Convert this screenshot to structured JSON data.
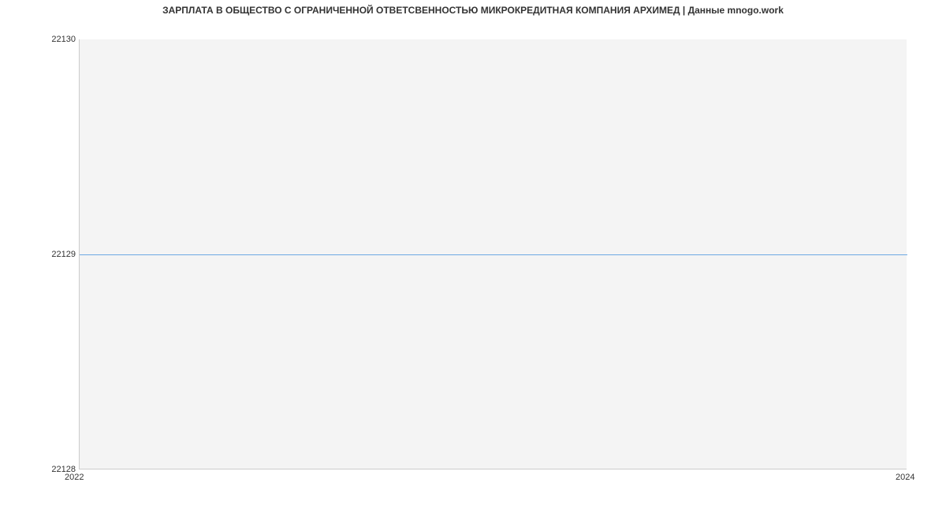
{
  "chart_data": {
    "type": "line",
    "title": "ЗАРПЛАТА В ОБЩЕСТВО С ОГРАНИЧЕННОЙ ОТВЕТСВЕННОСТЬЮ МИКРОКРЕДИТНАЯ КОМПАНИЯ АРХИМЕД | Данные mnogo.work",
    "x": [
      2022,
      2024
    ],
    "values": [
      22129,
      22129
    ],
    "xlabel": "",
    "ylabel": "",
    "x_ticks": [
      "2022",
      "2024"
    ],
    "y_ticks": [
      "22128",
      "22129",
      "22130"
    ],
    "ylim": [
      22128,
      22130
    ],
    "xlim": [
      2022,
      2024
    ]
  }
}
